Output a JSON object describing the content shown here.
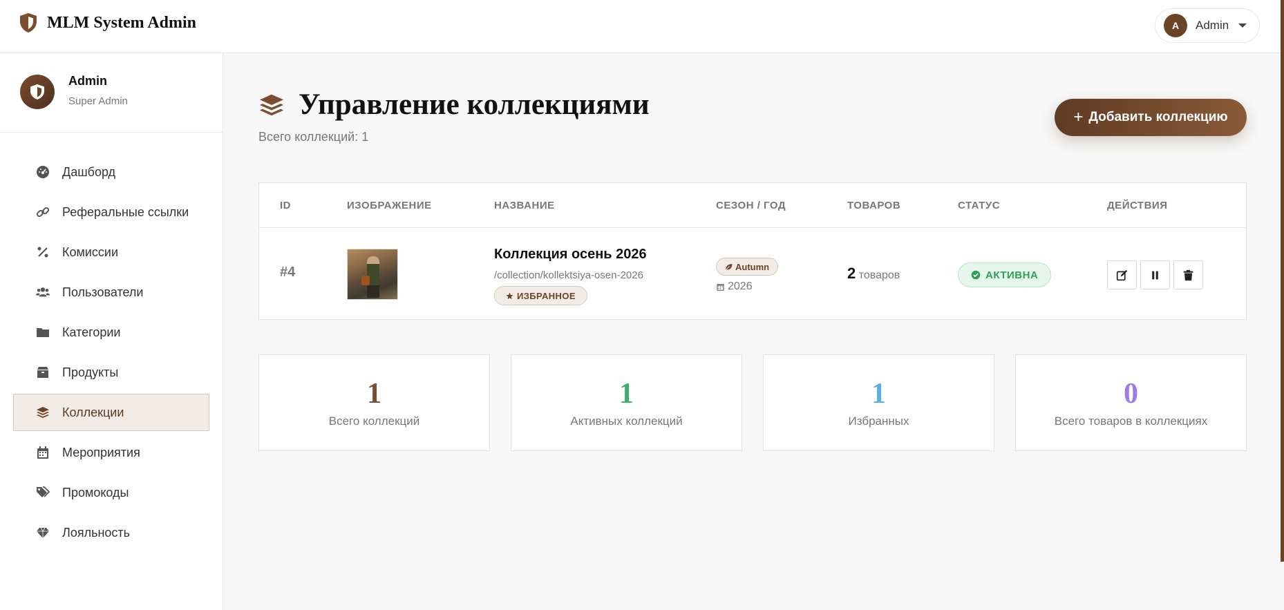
{
  "app": {
    "title": "MLM System Admin"
  },
  "user_menu": {
    "avatar_letter": "A",
    "name": "Admin"
  },
  "profile": {
    "name": "Admin",
    "role": "Super Admin"
  },
  "sidebar": {
    "items": [
      {
        "label": "Дашборд",
        "icon": "dashboard-icon",
        "active": false
      },
      {
        "label": "Реферальные ссылки",
        "icon": "link-icon",
        "active": false
      },
      {
        "label": "Комиссии",
        "icon": "percent-icon",
        "active": false
      },
      {
        "label": "Пользователи",
        "icon": "users-icon",
        "active": false
      },
      {
        "label": "Категории",
        "icon": "folder-icon",
        "active": false
      },
      {
        "label": "Продукты",
        "icon": "box-icon",
        "active": false
      },
      {
        "label": "Коллекции",
        "icon": "layers-icon",
        "active": true
      },
      {
        "label": "Мероприятия",
        "icon": "calendar-icon",
        "active": false
      },
      {
        "label": "Промокоды",
        "icon": "tags-icon",
        "active": false
      },
      {
        "label": "Лояльность",
        "icon": "gem-icon",
        "active": false
      }
    ]
  },
  "page": {
    "title": "Управление коллекциями",
    "subtitle": "Всего коллекций: 1",
    "add_button": "Добавить коллекцию"
  },
  "table": {
    "headers": [
      "ID",
      "ИЗОБРАЖЕНИЕ",
      "НАЗВАНИЕ",
      "СЕЗОН / ГОД",
      "ТОВАРОВ",
      "СТАТУС",
      "ДЕЙСТВИЯ"
    ],
    "rows": [
      {
        "id": "#4",
        "name": "Коллекция осень 2026",
        "slug": "/collection/kollektsiya-osen-2026",
        "featured_badge": "ИЗБРАННОЕ",
        "season": "Autumn",
        "year": "2026",
        "products_count": "2",
        "products_unit": "товаров",
        "status": "АКТИВНА"
      }
    ]
  },
  "stats": [
    {
      "value": "1",
      "label": "Всего коллекций",
      "color": "#7a4d2e"
    },
    {
      "value": "1",
      "label": "Активных коллекций",
      "color": "#3fae6a"
    },
    {
      "value": "1",
      "label": "Избранных",
      "color": "#5aaee6"
    },
    {
      "value": "0",
      "label": "Всего товаров в коллекциях",
      "color": "#a07ae6"
    }
  ],
  "colors": {
    "brand": "#6b4428",
    "success": "#2ea05a"
  }
}
